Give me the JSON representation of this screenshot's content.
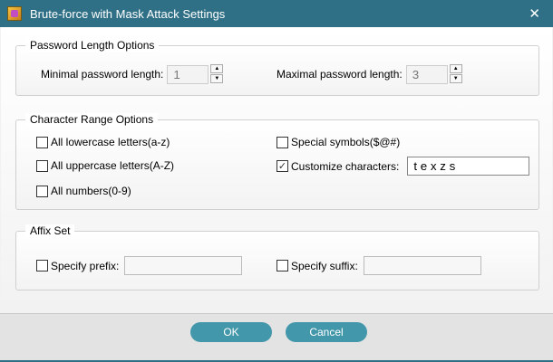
{
  "window": {
    "title": "Brute-force with Mask Attack Settings",
    "close": "✕"
  },
  "length": {
    "legend": "Password Length Options",
    "min_label": "Minimal password length:",
    "min_value": "1",
    "max_label": "Maximal password length:",
    "max_value": "3"
  },
  "range": {
    "legend": "Character Range Options",
    "lowercase": {
      "label": "All lowercase letters(a-z)",
      "checked": false
    },
    "uppercase": {
      "label": "All uppercase letters(A-Z)",
      "checked": false
    },
    "numbers": {
      "label": "All numbers(0-9)",
      "checked": false
    },
    "special": {
      "label": "Special symbols($@#)",
      "checked": false
    },
    "custom": {
      "label": "Customize characters:",
      "checked": true,
      "value": "t e x z s"
    }
  },
  "affix": {
    "legend": "Affix Set",
    "prefix_label": "Specify prefix:",
    "prefix_value": "",
    "suffix_label": "Specify suffix:",
    "suffix_value": ""
  },
  "buttons": {
    "ok": "OK",
    "cancel": "Cancel"
  }
}
